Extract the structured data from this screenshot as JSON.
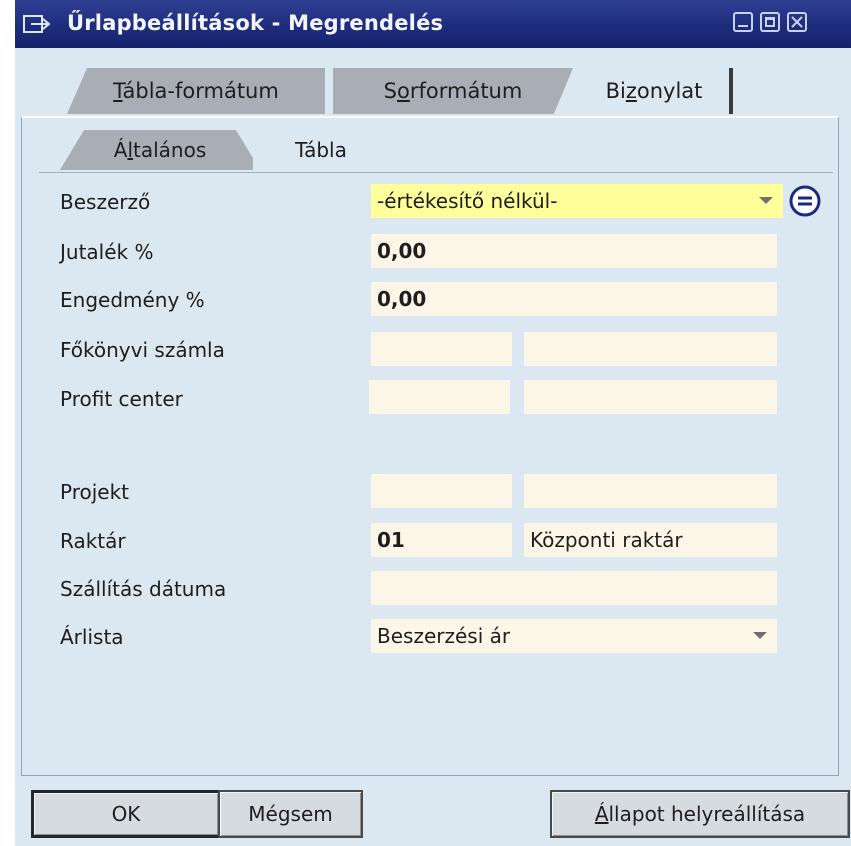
{
  "window": {
    "title": "Űrlapbeállítások - Megrendelés",
    "title_bg": "#1e2c7c",
    "body_bg": "#dbe7f1"
  },
  "main_tabs": [
    {
      "label": "Tábla-formátum",
      "mnemonic": "T",
      "rest": "ábla-formátum",
      "active": false
    },
    {
      "label": "Sorformátum",
      "before": "S",
      "mnemonic": "o",
      "rest": "rformátum",
      "active": false
    },
    {
      "label": "Bizonylat",
      "before": "Bi",
      "mnemonic": "z",
      "rest": "onylat",
      "active": true
    }
  ],
  "sub_tabs": [
    {
      "label": "Általános",
      "before": "Á",
      "mnemonic": "l",
      "rest": "talános",
      "active": false
    },
    {
      "label": "Tábla",
      "active": true
    }
  ],
  "fields": {
    "beszerzo": {
      "label": "Beszerző",
      "value": "-értékesítő nélkül-",
      "bg": "#ffff9c",
      "icon": "link-arrow-icon"
    },
    "jutalek": {
      "label": "Jutalék %",
      "value": "0,00"
    },
    "engedmeny": {
      "label": "Engedmény %",
      "value": "0,00"
    },
    "fokonyvi": {
      "label": "Főkönyvi számla",
      "value1": "",
      "value2": ""
    },
    "profit": {
      "label": "Profit center",
      "value1": "",
      "value2": ""
    },
    "projekt": {
      "label": "Projekt",
      "value1": "",
      "value2": ""
    },
    "raktar": {
      "label": "Raktár",
      "code": "01",
      "name": "Központi raktár"
    },
    "szallitas": {
      "label": "Szállítás dátuma",
      "value": ""
    },
    "arlista": {
      "label": "Árlista",
      "value": "Beszerzési ár"
    }
  },
  "buttons": {
    "ok": "OK",
    "cancel": "Mégsem",
    "reset": {
      "label": "Állapot helyreállítása",
      "mnemonic": "Á",
      "rest": "llapot helyreállítása"
    }
  }
}
